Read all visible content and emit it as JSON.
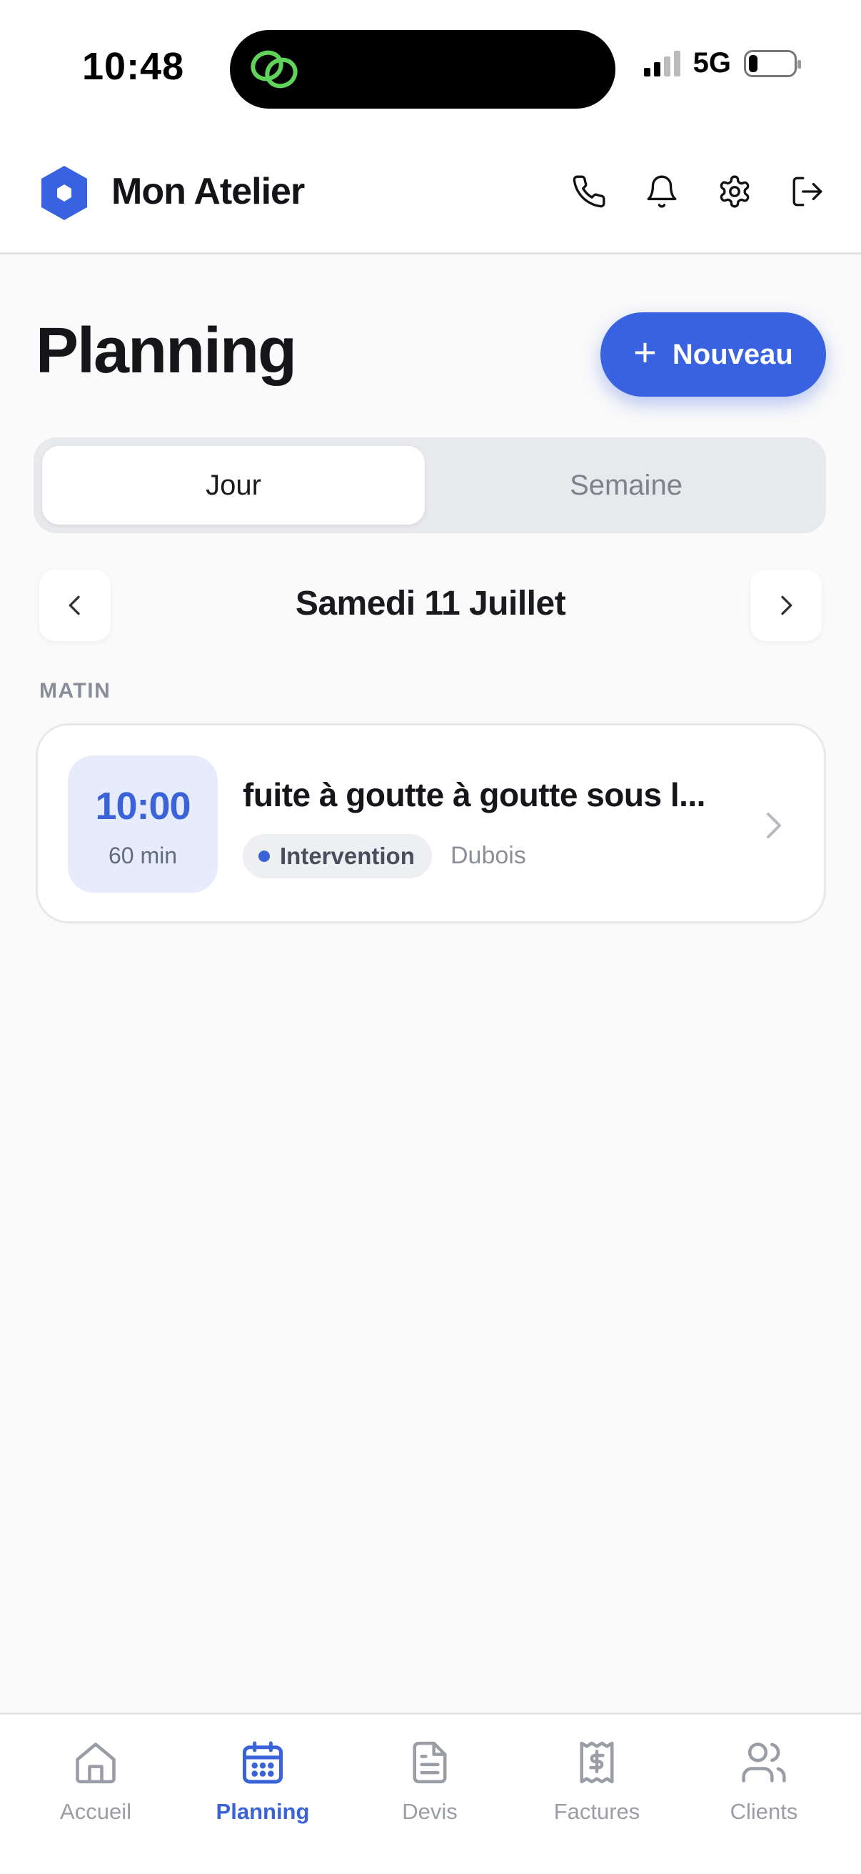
{
  "status_bar": {
    "time": "10:48",
    "network": "5G",
    "battery_level": 0.2
  },
  "header": {
    "app_title": "Mon Atelier",
    "logo_icon": "hexagon-logo-icon",
    "actions": [
      "phone-icon",
      "bell-icon",
      "gear-icon",
      "logout-icon"
    ]
  },
  "page": {
    "title": "Planning",
    "new_button_label": "Nouveau"
  },
  "view_toggle": {
    "day_label": "Jour",
    "week_label": "Semaine",
    "selected": "Jour"
  },
  "date_nav": {
    "date_label": "Samedi 11 Juillet"
  },
  "sections": {
    "morning_label": "MATIN"
  },
  "appointment": {
    "time": "10:00",
    "duration": "60 min",
    "title": "fuite à goutte à goutte sous l...",
    "type_label": "Intervention",
    "client": "Dubois"
  },
  "tab_bar": {
    "tabs": [
      {
        "label": "Accueil",
        "icon": "home-icon"
      },
      {
        "label": "Planning",
        "icon": "calendar-icon"
      },
      {
        "label": "Devis",
        "icon": "document-icon"
      },
      {
        "label": "Factures",
        "icon": "invoice-icon"
      },
      {
        "label": "Clients",
        "icon": "users-icon"
      }
    ],
    "active": "Planning"
  },
  "colors": {
    "accent": "#3862e0",
    "background": "#fafafa",
    "island_icon": "#5fd35a"
  }
}
